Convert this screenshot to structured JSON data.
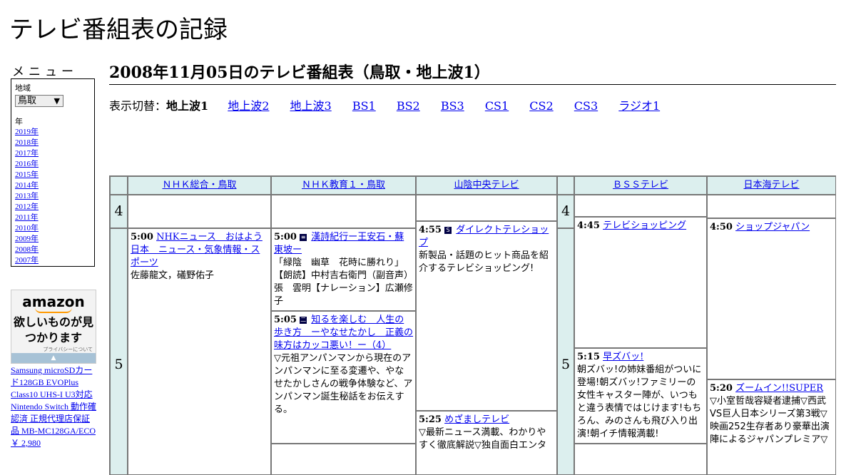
{
  "site": {
    "title": "テレビ番組表の記録"
  },
  "menu": {
    "heading": "メニュー",
    "region_label": "地域",
    "region_value": "鳥取",
    "year_label": "年",
    "years": [
      "2019年",
      "2018年",
      "2017年",
      "2016年",
      "2015年",
      "2014年",
      "2013年",
      "2012年",
      "2011年",
      "2010年",
      "2009年",
      "2008年",
      "2007年"
    ]
  },
  "ad": {
    "logo": "amazon",
    "text": "欲しいものが見つかります",
    "privacy": "プライバシーについて",
    "product": "Samsung microSDカード128GB EVOPlus Class10 UHS-I U3対応 Nintendo Switch 動作確認済 正規代理店保証品 MB-MC128GA/ECO",
    "price": "￥ 2,980"
  },
  "page": {
    "title": "2008年11月05日のテレビ番組表（鳥取・地上波1）"
  },
  "switch": {
    "label": "表示切替：",
    "current": "地上波1",
    "links": [
      "地上波2",
      "地上波3",
      "BS1",
      "BS2",
      "BS3",
      "CS1",
      "CS2",
      "CS3",
      "ラジオ1"
    ]
  },
  "grid": {
    "hours": [
      "4",
      "5"
    ],
    "channels": [
      "ＮＨＫ総合・鳥取",
      "ＮＨＫ教育１・鳥取",
      "山陰中央テレビ",
      "ＢＳＳテレビ",
      "日本海テレビ"
    ],
    "programs": {
      "nhk1_500": {
        "time": "5:00",
        "title": "NHKニュース　おはよう日本　ニュース・気象情報・スポーツ",
        "desc": "佐藤龍文，礒野佑子"
      },
      "etv_500": {
        "time": "5:00",
        "title": "漢詩紀行ー王安石・蘇東坡ー",
        "desc": "「緑陰　幽草　花時に勝れり」　【朗読】中村吉右衛門（副音声）張　雲明【ナレーション】広瀬修子"
      },
      "etv_505": {
        "time": "5:05",
        "title": "知るを楽しむ　人生の歩き方　ーやなせたかし　正義の味方はカッコ悪い！ー（4）",
        "desc": "▽元祖アンパンマンから現在のアンパンマンに至る変遷や、やなせたかしさんの戦争体験など、アンパンマン誕生秘話をお伝えする。"
      },
      "tsk_455": {
        "time": "4:55",
        "title": "ダイレクトテレショップ",
        "desc": "新製品・話題のヒット商品を紹介するテレビショッピング!"
      },
      "tsk_525": {
        "time": "5:25",
        "title": "めざましテレビ",
        "desc": "▽最新ニュース満載、わかりやすく徹底解説▽独自面白エンタ"
      },
      "bss_445": {
        "time": "4:45",
        "title": "テレビショッピング",
        "desc": ""
      },
      "bss_515": {
        "time": "5:15",
        "title": "早ズバッ!",
        "desc": "朝ズバッ!の姉妹番組がついに登場!朝ズバッ!ファミリーの女性キャスター陣が、いつもと違う表情ではじけます!もちろん、みのさんも飛び入り出演!朝イチ情報満載!"
      },
      "nkt_450": {
        "time": "4:50",
        "title": "ショップジャパン",
        "desc": ""
      },
      "nkt_520": {
        "time": "5:20",
        "title": "ズームイン!!SUPER",
        "desc": "▽小室哲哉容疑者逮捕▽西武VS巨人日本シリーズ第3戦▽映画252生存者あり豪華出演陣によるジャパンプレミア▽"
      }
    }
  }
}
